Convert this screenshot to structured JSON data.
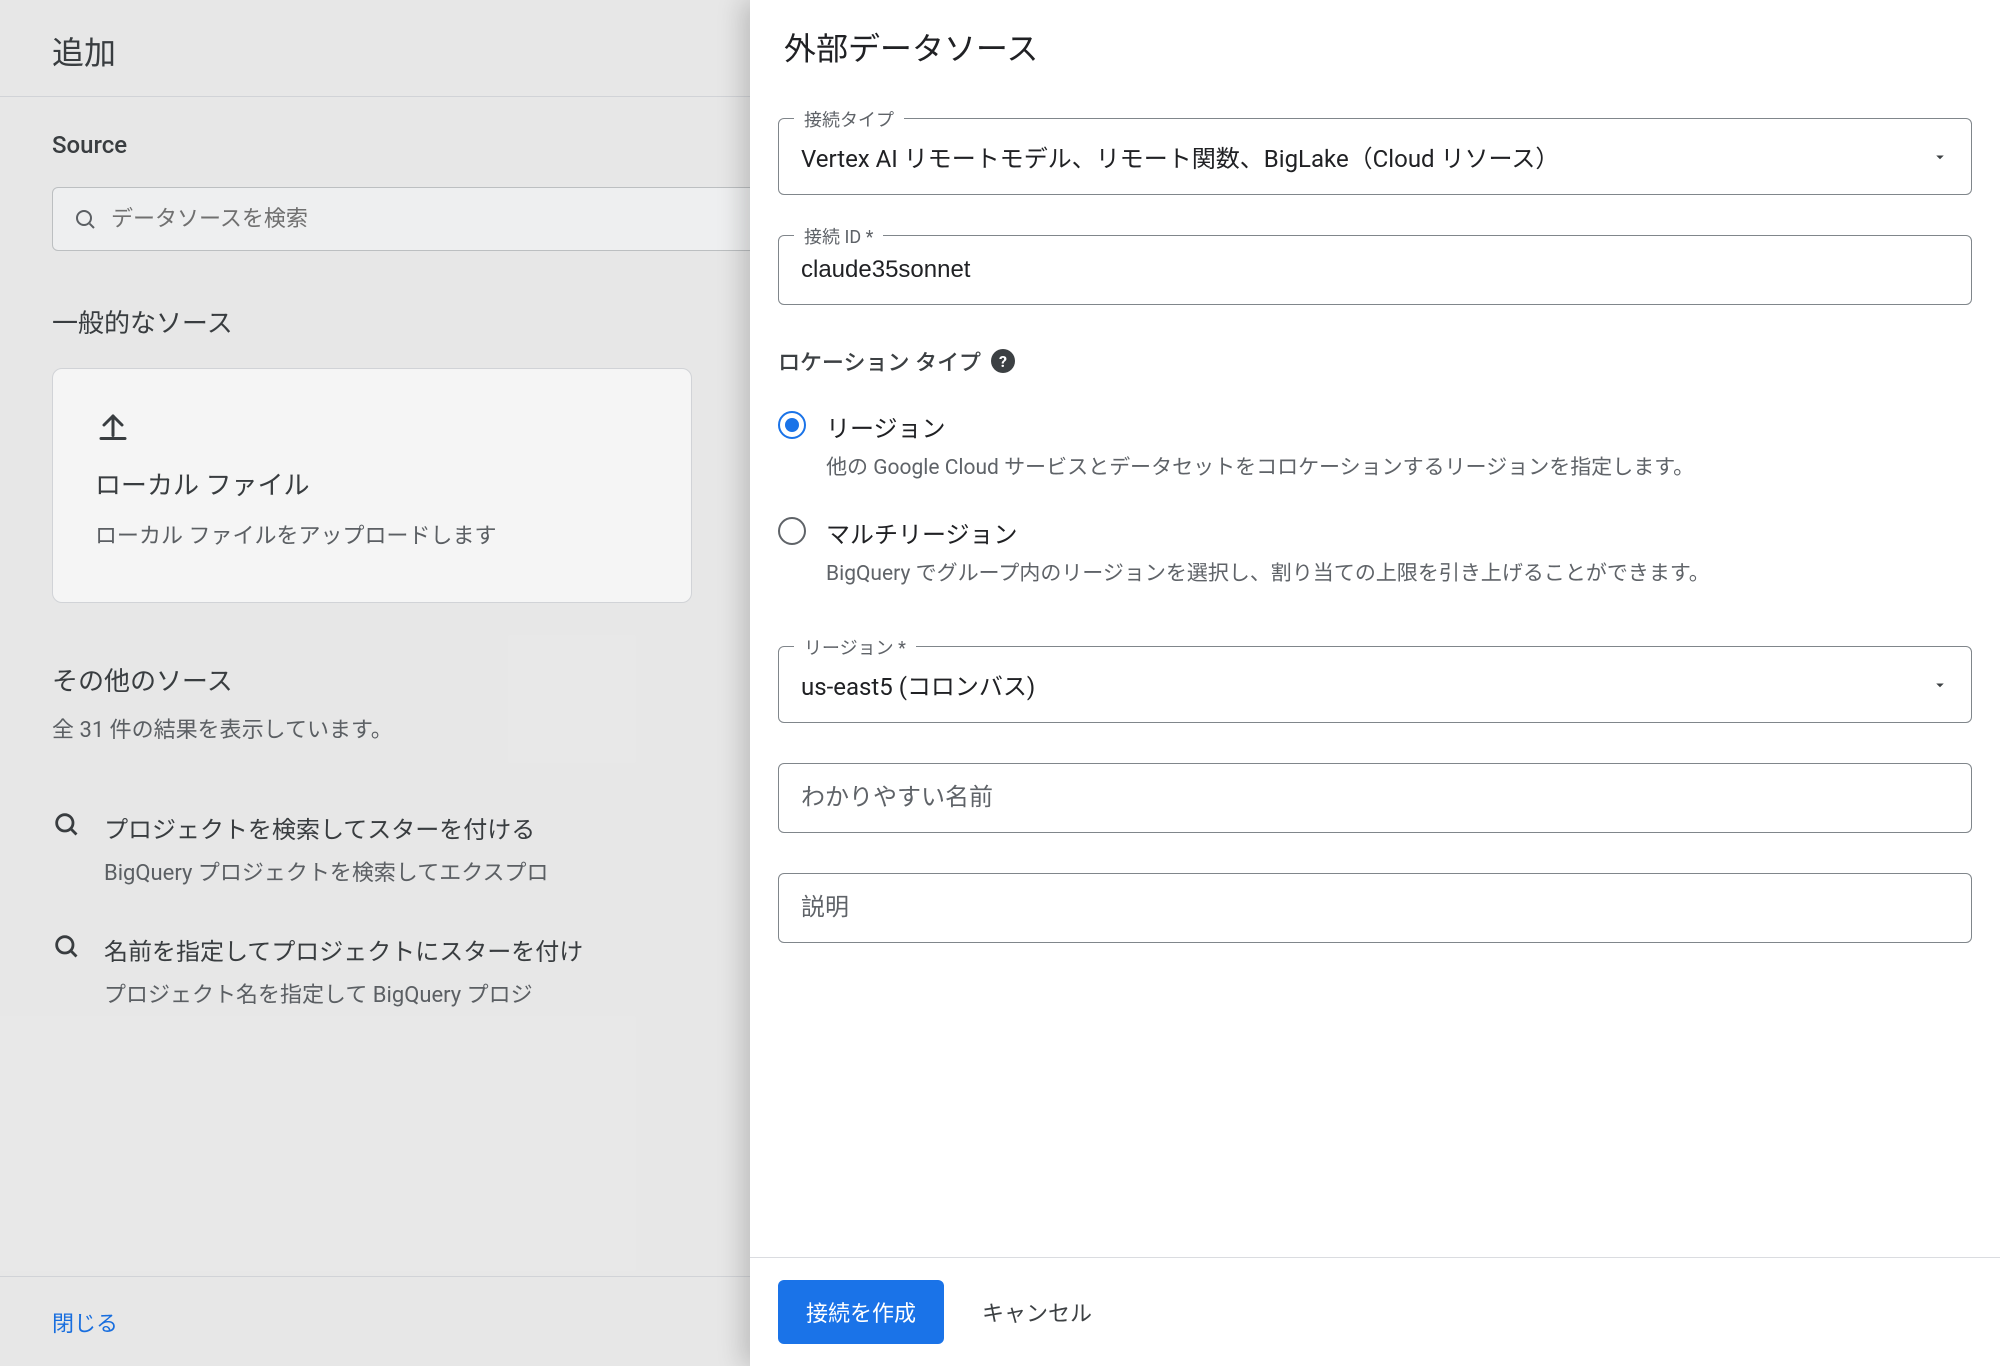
{
  "backdrop": {
    "title": "追加",
    "source_label": "Source",
    "search_placeholder": "データソースを検索",
    "common_sources_label": "一般的なソース",
    "card": {
      "title": "ローカル ファイル",
      "desc": "ローカル ファイルをアップロードします"
    },
    "other_sources_label": "その他のソース",
    "other_sources_count": "全 31 件の結果を表示しています。",
    "rows": [
      {
        "title": "プロジェクトを検索してスターを付ける",
        "desc": "BigQuery プロジェクトを検索してエクスプロ"
      },
      {
        "title": "名前を指定してプロジェクトにスターを付け",
        "desc": "プロジェクト名を指定して BigQuery プロジ"
      }
    ],
    "close_label": "閉じる"
  },
  "drawer": {
    "title": "外部データソース",
    "connection_type": {
      "label": "接続タイプ",
      "value": "Vertex AI リモートモデル、リモート関数、BigLake（Cloud リソース）"
    },
    "connection_id": {
      "label": "接続 ID *",
      "value": "claude35sonnet"
    },
    "location_type_label": "ロケーション タイプ",
    "radios": {
      "region": {
        "title": "リージョン",
        "desc": "他の Google Cloud サービスとデータセットをコロケーションするリージョンを指定します。"
      },
      "multiregion": {
        "title": "マルチリージョン",
        "desc": "BigQuery でグループ内のリージョンを選択し、割り当ての上限を引き上げることができます。"
      },
      "selected": "region"
    },
    "region": {
      "label": "リージョン *",
      "value": "us-east5 (コロンバス)"
    },
    "friendly_name_placeholder": "わかりやすい名前",
    "description_placeholder": "説明",
    "create_button": "接続を作成",
    "cancel_button": "キャンセル"
  }
}
